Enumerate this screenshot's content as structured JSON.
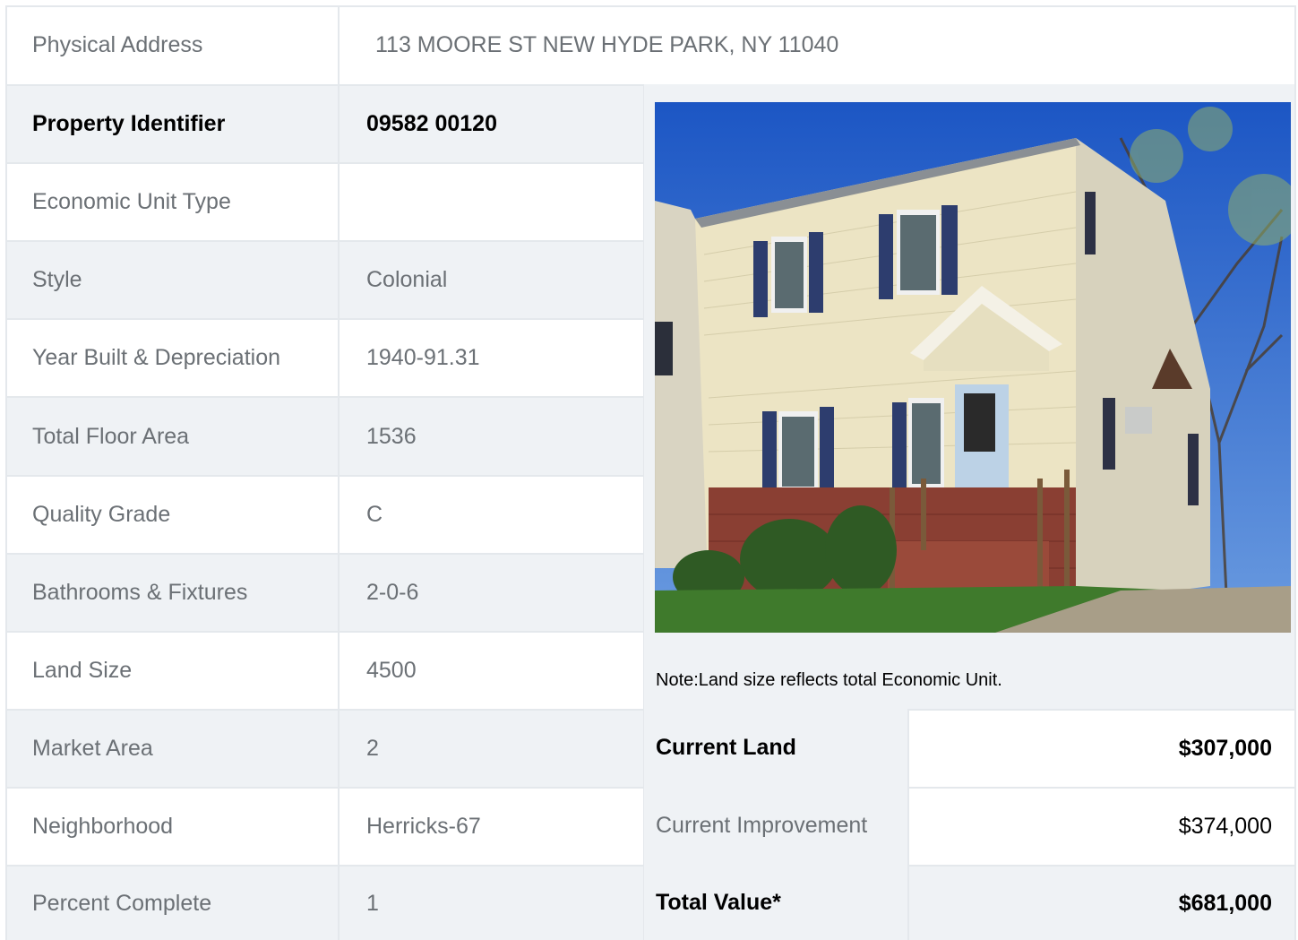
{
  "address": {
    "label": "Physical Address",
    "value": "113  MOORE ST  NEW HYDE PARK, NY  11040"
  },
  "property": [
    {
      "label": "Property Identifier",
      "value": "09582  00120"
    },
    {
      "label": "Economic Unit Type",
      "value": ""
    },
    {
      "label": "Style",
      "value": "Colonial"
    },
    {
      "label": "Year Built & Depreciation",
      "value": "1940-91.31"
    },
    {
      "label": "Total Floor Area",
      "value": "1536"
    },
    {
      "label": "Quality Grade",
      "value": "C"
    },
    {
      "label": "Bathrooms & Fixtures",
      "value": "2-0-6"
    },
    {
      "label": "Land Size",
      "value": "4500"
    },
    {
      "label": "Market Area",
      "value": "2"
    },
    {
      "label": "Neighborhood",
      "value": "Herricks-67"
    },
    {
      "label": "Percent Complete",
      "value": "1"
    }
  ],
  "photo": {
    "icon": "house-photo"
  },
  "note": "Note:Land size reflects total Economic Unit.",
  "valuation": [
    {
      "label": "Current Land",
      "value": "$307,000"
    },
    {
      "label": "Current Improvement",
      "value": "$374,000"
    },
    {
      "label": "Total Value*",
      "value": "$681,000"
    }
  ],
  "colors": {
    "row_shade": "#eff2f5",
    "border": "#e4e8ec",
    "label_text": "#6b7075"
  }
}
